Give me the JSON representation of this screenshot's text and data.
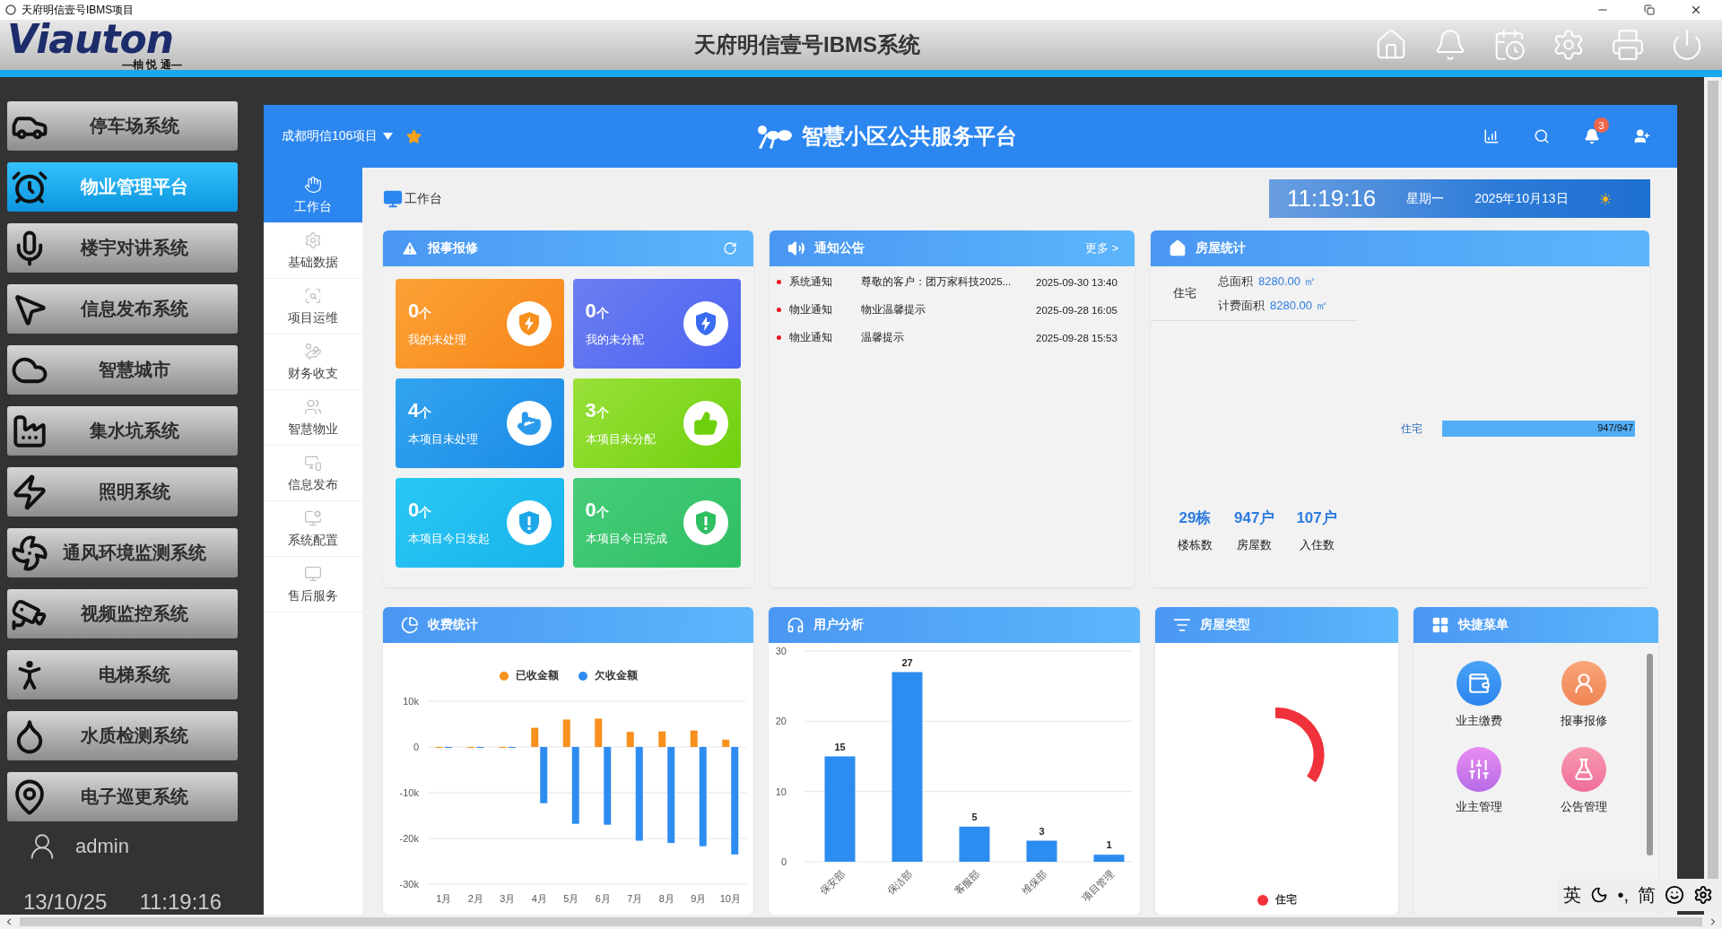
{
  "window": {
    "title": "天府明信壹号IBMS项目"
  },
  "header": {
    "logo": "Viauton",
    "tagline": "—柚 悦 通—",
    "title": "天府明信壹号IBMS系统"
  },
  "systems": [
    {
      "label": "停车场系统",
      "selected": false
    },
    {
      "label": "物业管理平台",
      "selected": true
    },
    {
      "label": "楼宇对讲系统",
      "selected": false
    },
    {
      "label": "信息发布系统",
      "selected": false
    },
    {
      "label": "智慧城市",
      "selected": false
    },
    {
      "label": "集水坑系统",
      "selected": false
    },
    {
      "label": "照明系统",
      "selected": false
    },
    {
      "label": "通风环境监测系统",
      "selected": false
    },
    {
      "label": "视频监控系统",
      "selected": false
    },
    {
      "label": "电梯系统",
      "selected": false
    },
    {
      "label": "水质检测系统",
      "selected": false
    },
    {
      "label": "电子巡更系统",
      "selected": false
    }
  ],
  "user": {
    "name": "admin"
  },
  "clock": {
    "date": "13/10/25",
    "time": "11:19:16"
  },
  "app": {
    "project": "成都明信106项目",
    "title": "智慧小区公共服务平台",
    "notification_count": "3"
  },
  "nav": [
    {
      "label": "工作台",
      "selected": true
    },
    {
      "label": "基础数据",
      "selected": false
    },
    {
      "label": "项目运维",
      "selected": false
    },
    {
      "label": "财务收支",
      "selected": false
    },
    {
      "label": "智慧物业",
      "selected": false
    },
    {
      "label": "信息发布",
      "selected": false
    },
    {
      "label": "系统配置",
      "selected": false
    },
    {
      "label": "售后服务",
      "selected": false
    }
  ],
  "breadcrumb": "工作台",
  "datetime": {
    "time": "11:19:16",
    "weekday": "星期一",
    "date": "2025年10月13日"
  },
  "repairs": {
    "title": "报事报修",
    "tiles": [
      {
        "count": "0",
        "unit": "个",
        "label": "我的未处理"
      },
      {
        "count": "0",
        "unit": "个",
        "label": "我的未分配"
      },
      {
        "count": "4",
        "unit": "个",
        "label": "本项目未处理"
      },
      {
        "count": "3",
        "unit": "个",
        "label": "本项目未分配"
      },
      {
        "count": "0",
        "unit": "个",
        "label": "本项目今日发起"
      },
      {
        "count": "0",
        "unit": "个",
        "label": "本项目今日完成"
      }
    ]
  },
  "notices": {
    "title": "通知公告",
    "more": "更多 >",
    "rows": [
      {
        "type": "系统通知",
        "text": "尊敬的客户：团万家科技2025...",
        "time": "2025-09-30 13:40"
      },
      {
        "type": "物业通知",
        "text": "物业温馨提示",
        "time": "2025-09-28 16:05"
      },
      {
        "type": "物业通知",
        "text": "温馨提示",
        "time": "2025-09-28 15:53"
      }
    ]
  },
  "housing": {
    "title": "房屋统计",
    "area_type": "住宅",
    "area_rows": [
      {
        "label": "总面积",
        "value": "8280.00 ㎡"
      },
      {
        "label": "计费面积",
        "value": "8280.00 ㎡"
      }
    ],
    "occupancy": {
      "label": "住宅",
      "level": 1,
      "reading": "947/947"
    },
    "stats": [
      {
        "value": "29栋",
        "label": "楼栋数"
      },
      {
        "value": "947户",
        "label": "房屋数"
      },
      {
        "value": "107户",
        "label": "入住数"
      }
    ]
  },
  "fees": {
    "title": "收费统计",
    "chart_data": {
      "type": "bar",
      "categories": [
        "1月",
        "2月",
        "3月",
        "4月",
        "5月",
        "6月",
        "7月",
        "8月",
        "9月",
        "10月"
      ],
      "series": [
        {
          "name": "已收金额",
          "color": "#f7901e",
          "values": [
            0,
            0,
            0,
            4200,
            6000,
            6200,
            3300,
            3400,
            3600,
            1600
          ]
        },
        {
          "name": "欠收金额",
          "color": "#2d8cf0",
          "values": [
            -200,
            -200,
            -200,
            -12300,
            -16800,
            -17000,
            -20500,
            -21000,
            -21700,
            -23500
          ]
        }
      ],
      "ylim": [
        -30000,
        10000
      ],
      "grid": true,
      "yticks": [
        {
          "value": 10000,
          "label": "10k"
        },
        {
          "value": 0,
          "label": "0"
        },
        {
          "value": -10000,
          "label": "-10k"
        },
        {
          "value": -20000,
          "label": "-20k"
        },
        {
          "value": -30000,
          "label": "-30k"
        }
      ]
    }
  },
  "users": {
    "title": "用户分析",
    "chart_data": {
      "type": "bar",
      "categories": [
        "保安部",
        "保洁部",
        "客服部",
        "维保部",
        "项目管理"
      ],
      "values": [
        15,
        27,
        5,
        3,
        1
      ],
      "ylim": [
        0,
        30
      ],
      "grid": true,
      "yticks": [
        0,
        10,
        20,
        30
      ],
      "data_labels": true
    }
  },
  "room_types": {
    "title": "房屋类型",
    "legend": [
      {
        "label": "住宅",
        "color": "#f0323c"
      }
    ]
  },
  "shortcuts": {
    "title": "快捷菜单",
    "items": [
      {
        "label": "业主缴费"
      },
      {
        "label": "报事报修"
      },
      {
        "label": "业主管理"
      },
      {
        "label": "公告管理"
      }
    ]
  },
  "ime": {
    "language": "英",
    "punctuation": "•,",
    "charset": "简"
  }
}
